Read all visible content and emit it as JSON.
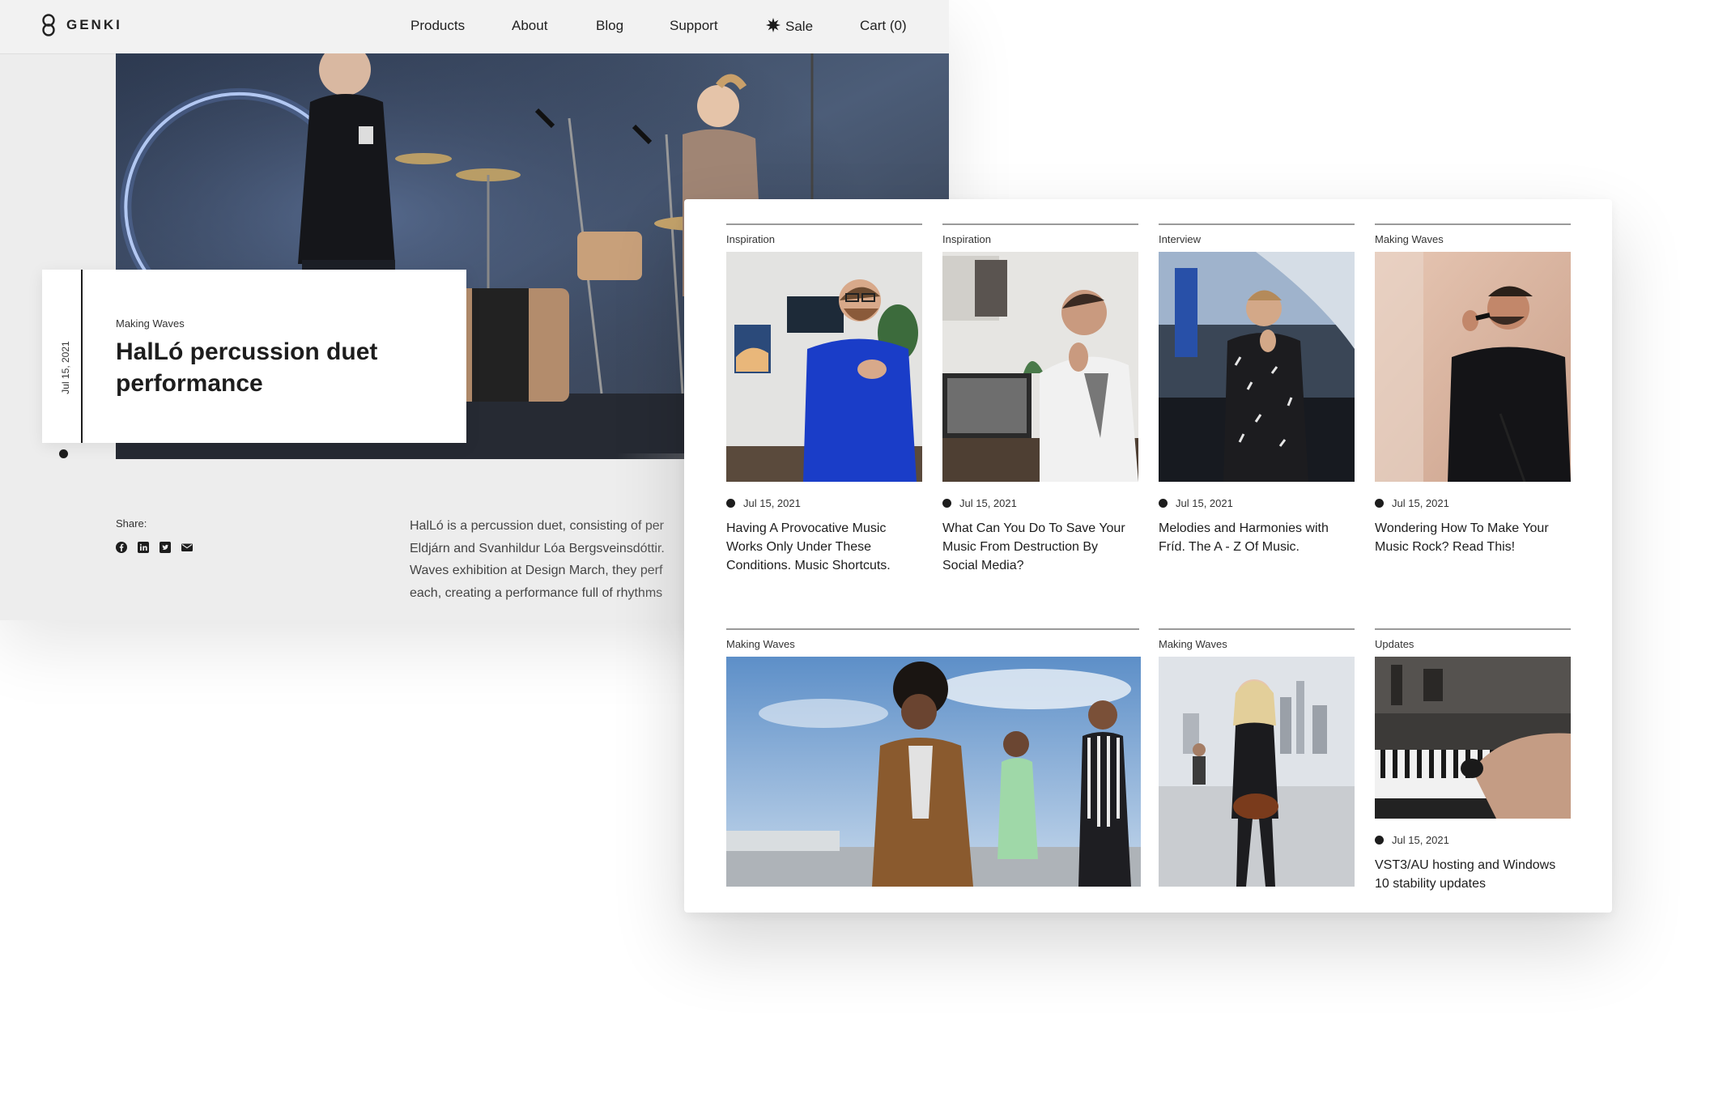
{
  "brand": {
    "name": "GENKI",
    "logo_icon": "genki-ring-logo"
  },
  "nav": {
    "items": [
      {
        "label": "Products"
      },
      {
        "label": "About"
      },
      {
        "label": "Blog"
      },
      {
        "label": "Support"
      },
      {
        "label": "Sale",
        "icon": "starburst-icon"
      },
      {
        "label": "Cart (0)"
      }
    ]
  },
  "hero": {
    "category": "Making Waves",
    "date": "Jul 15, 2021",
    "title": "HalLó percussion duet performance",
    "image": "musicians-drums-photo"
  },
  "share": {
    "label": "Share:",
    "icons": [
      "facebook-icon",
      "linkedin-icon",
      "twitter-icon",
      "mail-icon"
    ]
  },
  "article": {
    "lines": [
      "HalLó is a percussion duet, consisting of per",
      "Eldjárn and Svanhildur Lóa Bergsveinsdóttir.",
      "Waves exhibition at Design March, they perf",
      "each, creating a performance full of rhythms"
    ]
  },
  "posts_row1": [
    {
      "category": "Inspiration",
      "date": "Jul 15, 2021",
      "title": "Having A Provocative Music Works Only Under These Conditions. Music Shortcuts."
    },
    {
      "category": "Inspiration",
      "date": "Jul 15, 2021",
      "title": "What Can You Do To Save Your Music From Destruction By Social Media?"
    },
    {
      "category": "Interview",
      "date": "Jul 15, 2021",
      "title": "Melodies and Harmonies with Fríd. The A - Z Of Music."
    },
    {
      "category": "Making Waves",
      "date": "Jul 15, 2021",
      "title": "Wondering How To Make Your Music Rock? Read This!"
    }
  ],
  "posts_row2": [
    {
      "category": "Making Waves"
    },
    {
      "category": "Making Waves"
    },
    {
      "category": "Updates",
      "date": "Jul 15, 2021",
      "title": "VST3/AU hosting and Windows 10 stability updates"
    }
  ],
  "colors": {
    "text": "#1d1d1d",
    "nav_bg": "#f2f2f2",
    "rule": "#9a9a9a"
  }
}
